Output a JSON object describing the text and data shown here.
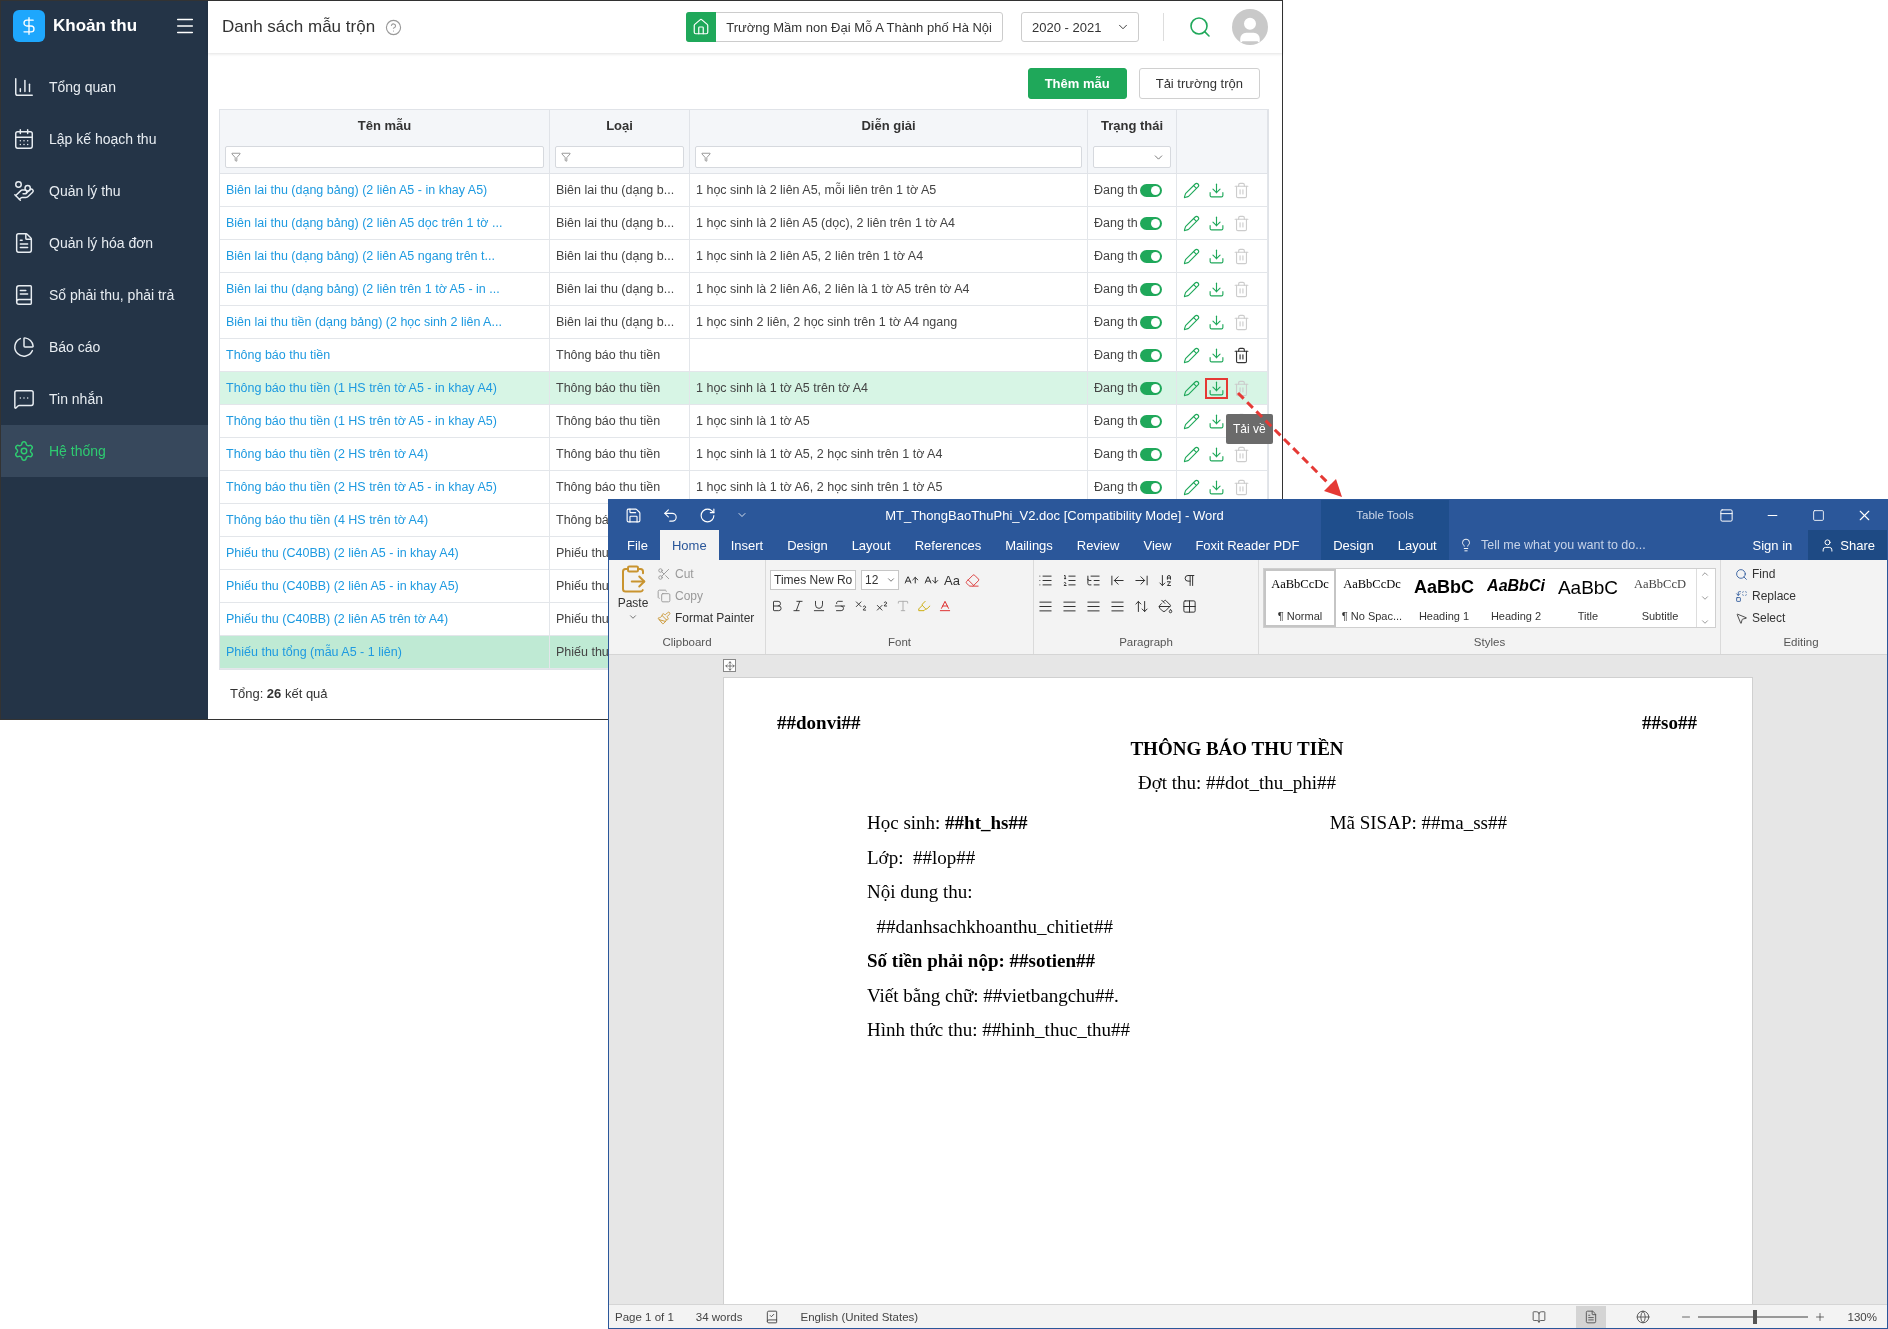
{
  "app": {
    "logo": "Khoản thu",
    "sidebar": {
      "items": [
        {
          "label": "Tổng quan",
          "selected": false
        },
        {
          "label": "Lập kế hoạch thu",
          "selected": false
        },
        {
          "label": "Quản lý thu",
          "selected": false
        },
        {
          "label": "Quản lý hóa đơn",
          "selected": false
        },
        {
          "label": "Sổ phải thu, phải trả",
          "selected": false
        },
        {
          "label": "Báo cáo",
          "selected": false
        },
        {
          "label": "Tin nhắn",
          "selected": false
        },
        {
          "label": "Hệ thống",
          "selected": true
        }
      ]
    },
    "header": {
      "title": "Danh sách mẫu trộn",
      "school": "Trường Mầm non Đại Mỗ A Thành phố Hà Nội",
      "year": "2020 - 2021"
    },
    "buttons": [
      {
        "label": "Thêm mẫu",
        "kind": "primary"
      },
      {
        "label": "Tải trường trộn",
        "kind": "secondary"
      }
    ],
    "table": {
      "columns": [
        "Tên mẫu",
        "Loại",
        "Diễn giải",
        "Trạng thái"
      ],
      "rows": [
        {
          "name": "Biên lai thu (dạng bảng) (2 liên A5 - in khay A5)",
          "type": "Biên lai thu (dạng b...",
          "description": "1 học sinh là 2 liên A5, mỗi liên trên 1 tờ A5",
          "status": "Đang th",
          "on": true,
          "delete_enabled": false,
          "download_marked": false,
          "hovered": false,
          "selected": false
        },
        {
          "name": "Biên lai thu (dạng bảng) (2 liên A5 dọc trên 1 tờ ...",
          "type": "Biên lai thu (dạng b...",
          "description": "1 học sinh là 2 liên A5 (dọc), 2 liên trên 1 tờ A4",
          "status": "Đang th",
          "on": true,
          "delete_enabled": false,
          "download_marked": false,
          "hovered": false,
          "selected": false
        },
        {
          "name": "Biên lai thu (dạng bảng) (2 liên A5 ngang trên t...",
          "type": "Biên lai thu (dạng b...",
          "description": "1 học sinh là 2 liên A5, 2 liên trên 1 tờ A4",
          "status": "Đang th",
          "on": true,
          "delete_enabled": false,
          "download_marked": false,
          "hovered": false,
          "selected": false
        },
        {
          "name": "Biên lai thu (dạng bảng) (2 liên trên 1 tờ A5 - in ...",
          "type": "Biên lai thu (dạng b...",
          "description": "1 học sinh là 2 liên A6, 2 liên là 1 tờ A5 trên tờ A4",
          "status": "Đang th",
          "on": true,
          "delete_enabled": false,
          "download_marked": false,
          "hovered": false,
          "selected": false
        },
        {
          "name": "Biên lai thu tiền (dạng bảng) (2 học sinh 2 liên A...",
          "type": "Biên lai thu (dạng b...",
          "description": "1 học sinh 2 liên, 2 học sinh trên 1 tờ A4 ngang",
          "status": "Đang th",
          "on": true,
          "delete_enabled": false,
          "download_marked": false,
          "hovered": false,
          "selected": false
        },
        {
          "name": "Thông báo thu tiền",
          "type": "Thông báo thu tiền",
          "status": "Đang th",
          "on": true,
          "delete_enabled": true,
          "download_marked": false,
          "hovered": false,
          "selected": false
        },
        {
          "name": "Thông báo thu tiền (1 HS trên tờ A5 - in khay A4)",
          "type": "Thông báo thu tiền",
          "description": "1 học sinh là 1 tờ A5 trên tờ A4",
          "status": "Đang th",
          "on": true,
          "delete_enabled": false,
          "download_marked": true,
          "hovered": true,
          "selected": false
        },
        {
          "name": "Thông báo thu tiền (1 HS trên tờ A5 - in khay A5)",
          "type": "Thông báo thu tiền",
          "description": "1 học sinh là 1 tờ A5",
          "status": "Đang th",
          "on": true,
          "delete_enabled": false,
          "download_marked": false,
          "hovered": false,
          "selected": false
        },
        {
          "name": "Thông báo thu tiền (2 HS trên tờ A4)",
          "type": "Thông báo thu tiền",
          "description": "1 học sinh là 1 tờ A5, 2 học sinh trên 1 tờ A4",
          "status": "Đang th",
          "on": true,
          "delete_enabled": false,
          "download_marked": false,
          "hovered": false,
          "selected": false
        },
        {
          "name": "Thông báo thu tiền (2 HS trên tờ A5 - in khay A5)",
          "type": "Thông báo thu tiền",
          "description": "1 học sinh là 1 tờ A6, 2 học sinh trên 1 tờ A5",
          "status": "Đang th",
          "on": true,
          "delete_enabled": false,
          "download_marked": false,
          "hovered": false,
          "selected": false
        },
        {
          "name": "Thông báo thu tiền (4 HS trên tờ A4)",
          "type": "Thông bá",
          "hovered": false,
          "selected": false
        },
        {
          "name": "Phiếu thu (C40BB) (2 liên A5 - in khay A4)",
          "type": "Phiếu thu",
          "hovered": false,
          "selected": false
        },
        {
          "name": "Phiếu thu (C40BB) (2 liên A5 - in khay A5)",
          "type": "Phiếu thu",
          "hovered": false,
          "selected": false
        },
        {
          "name": "Phiếu thu (C40BB) (2 liên A5 trên tờ A4)",
          "type": "Phiếu thu",
          "hovered": false,
          "selected": false
        },
        {
          "name": "Phiếu thu tổng (mẫu A5 - 1 liên)",
          "type": "Phiếu thu",
          "hovered": false,
          "selected": true
        }
      ]
    },
    "tooltip": "Tải về",
    "total": "Tổng: **26** kết quả"
  },
  "word": {
    "title": "MT_ThongBaoThuPhi_V2.doc [Compatibility Mode] - Word",
    "context_group": "Table Tools",
    "tabs": [
      {
        "label": "File",
        "selected": false
      },
      {
        "label": "Home",
        "selected": true
      },
      {
        "label": "Insert",
        "selected": false
      },
      {
        "label": "Design",
        "selected": false
      },
      {
        "label": "Layout",
        "selected": false
      },
      {
        "label": "References",
        "selected": false
      },
      {
        "label": "Mailings",
        "selected": false
      },
      {
        "label": "Review",
        "selected": false
      },
      {
        "label": "View",
        "selected": false
      },
      {
        "label": "Foxit Reader PDF",
        "selected": false
      }
    ],
    "context_tabs": [
      {
        "label": "Design",
        "selected": false
      },
      {
        "label": "Layout",
        "selected": false
      }
    ],
    "tell_me": "Tell me what you want to do...",
    "sign_in": "Sign in",
    "share": "Share",
    "clipboard": {
      "paste": "Paste",
      "cut": "Cut",
      "copy": "Copy",
      "format_painter": "Format Painter",
      "label": "Clipboard"
    },
    "font": {
      "name": "Times New Ro",
      "size": "12",
      "change_case": "Aa",
      "label": "Font"
    },
    "paragraph": {
      "label": "Paragraph"
    },
    "styles": {
      "label": "Styles",
      "items": [
        {
          "preview": "AaBbCcDc",
          "name": "¶ Normal",
          "kind": "normal",
          "selected": true
        },
        {
          "preview": "AaBbCcDc",
          "name": "¶ No Spac...",
          "kind": "normal",
          "selected": false
        },
        {
          "preview": "AaBbC",
          "name": "Heading 1",
          "kind": "heading1",
          "selected": false
        },
        {
          "preview": "AaBbCi",
          "name": "Heading 2",
          "kind": "heading2",
          "selected": false
        },
        {
          "preview": "AaBbC",
          "name": "Title",
          "kind": "title",
          "selected": false
        },
        {
          "preview": "AaBbCcD",
          "name": "Subtitle",
          "kind": "subtitle",
          "selected": false
        }
      ]
    },
    "editing": {
      "label": "Editing",
      "find": "Find",
      "replace": "Replace",
      "select": "Select"
    },
    "document": {
      "header_left": "##donvi##",
      "header_right": "##so##",
      "title": "THÔNG BÁO THU TIỀN",
      "subtitle": "Đợt thu: ##dot_thu_phi##",
      "lines": [
        {
          "text": "Học sinh: **##ht_hs##**",
          "right": "Mã SISAP: ##ma_ss##",
          "kind": "plain"
        },
        {
          "text": "Lớp:  ##lop##",
          "kind": "plain"
        },
        {
          "text": "Nội dung thu:",
          "kind": "plain"
        },
        {
          "text": "  ##danhsachkhoanthu_chitiet##",
          "kind": "plain"
        },
        {
          "text": "Số tiền phải nộp: ##sotien##",
          "kind": "bold"
        },
        {
          "text": "Viết bằng chữ: ##vietbangchu##.",
          "kind": "plain"
        },
        {
          "text": "Hình thức thu: ##hinh_thuc_thu##",
          "kind": "plain"
        }
      ]
    },
    "status": {
      "page": "Page 1 of 1",
      "words": "34 words",
      "language": "English (United States)",
      "zoom": "130%",
      "level": 0.52
    }
  }
}
